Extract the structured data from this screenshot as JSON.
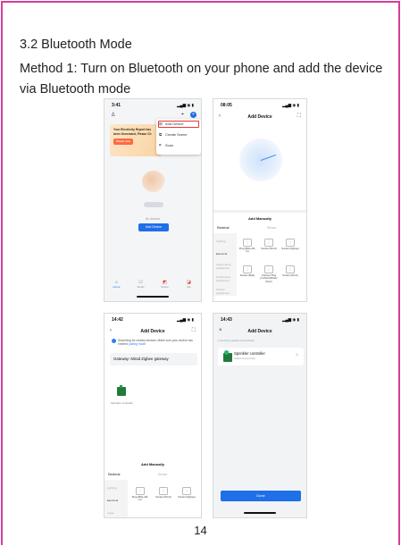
{
  "document": {
    "heading": "3.2 Bluetooth Mode",
    "body": "Method 1: Turn on Bluetooth on your phone and add the device via Bluetooth mode",
    "page_number": "14",
    "colors": {
      "frame": "#d63d9b",
      "accent": "#1e6fe8",
      "highlight": "#e53935"
    }
  },
  "shot1": {
    "time": "3:41",
    "banner_text": "Your Electricity Report has been Generated, Please Ch",
    "banner_pill": "Check now",
    "menu": [
      {
        "label": "Add Device",
        "icon": "add-device-icon"
      },
      {
        "label": "Create Scene",
        "icon": "scene-icon"
      },
      {
        "label": "Scan",
        "icon": "scan-icon"
      }
    ],
    "no_devices": "No devices",
    "add_device_button": "Add Device",
    "tabs": [
      "Home",
      "Smart",
      "Scene",
      "Me"
    ]
  },
  "shot2": {
    "time": "08:05",
    "title": "Add Device",
    "add_manually": "Add Manually",
    "tab_left": "Electrical",
    "tab_right": "Sensor",
    "categories": [
      "Lighting",
      "Electrical",
      "Large Home Appliances",
      "Small Home Appliances",
      "Kitchen Appliances"
    ],
    "row1": [
      "Plug (BLE+Wi-Fi)",
      "Socket (Wi-Fi)",
      "Socket (Zigbee)"
    ],
    "row2": [
      "Socket (BLE)",
      "Outdoor Plug (2.4GHz&5GHz Wi-Fi)",
      "Socket (Wi-Fi)"
    ]
  },
  "shot3": {
    "time": "14:42",
    "title": "Add Device",
    "scan_text": "Searching for nearby devices. Make sure your device has entered",
    "scan_link": "pairing mode",
    "gateway": "Gateway: Mirad Zigbee gateway",
    "device_label": "Sprinkler controller",
    "add_manually": "Add Manually",
    "tab_left": "Electrical",
    "tab_right": "Sensor",
    "categories": [
      "Lighting",
      "Electrical",
      "Large"
    ],
    "row1": [
      "Plug (BLE+Wi-Fi)",
      "Socket (Wi-Fi)",
      "Socket (Zigbee)"
    ]
  },
  "shot4": {
    "time": "14:43",
    "title": "Add Device",
    "added_text": "1 device(s) added successfully",
    "device_name": "Sprinkler controller",
    "device_sub": "Added successfully",
    "done": "Done"
  }
}
